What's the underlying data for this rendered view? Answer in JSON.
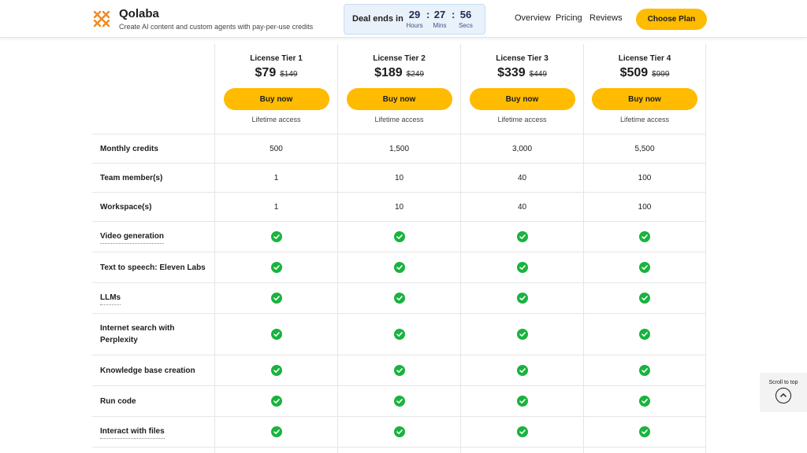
{
  "header": {
    "brand_name": "Qolaba",
    "tagline": "Create AI content and custom agents with pay-per-use credits",
    "deal": {
      "label": "Deal ends in",
      "hours": "29",
      "hours_label": "Hours",
      "mins": "27",
      "mins_label": "Mins",
      "secs": "56",
      "secs_label": "Secs"
    },
    "nav": [
      "Overview",
      "Pricing",
      "Reviews"
    ],
    "cta": "Choose Plan",
    "accent_color": "#ffbb00"
  },
  "tiers": [
    {
      "name": "License Tier 1",
      "price": "$79",
      "old_price": "$149",
      "button": "Buy now",
      "note": "Lifetime access"
    },
    {
      "name": "License Tier 2",
      "price": "$189",
      "old_price": "$249",
      "button": "Buy now",
      "note": "Lifetime access"
    },
    {
      "name": "License Tier 3",
      "price": "$339",
      "old_price": "$449",
      "button": "Buy now",
      "note": "Lifetime access"
    },
    {
      "name": "License Tier 4",
      "price": "$509",
      "old_price": "$999",
      "button": "Buy now",
      "note": "Lifetime access"
    }
  ],
  "features": [
    {
      "label": "Monthly credits",
      "values": [
        "500",
        "1,500",
        "3,000",
        "5,500"
      ]
    },
    {
      "label": "Team member(s)",
      "values": [
        "1",
        "10",
        "40",
        "100"
      ]
    },
    {
      "label": "Workspace(s)",
      "values": [
        "1",
        "10",
        "40",
        "100"
      ]
    },
    {
      "label": "Video generation",
      "check": true
    },
    {
      "label": "Text to speech: Eleven Labs",
      "check": true
    },
    {
      "label": "LLMs",
      "check": true
    },
    {
      "label": "Internet search with Perplexity",
      "check": true
    },
    {
      "label": "Knowledge base creation",
      "check": true
    },
    {
      "label": "Run code",
      "check": true
    },
    {
      "label": "Interact with files",
      "check": true
    }
  ],
  "check_icon": "check-circle-icon",
  "check_color": "#19b33f",
  "scroll_top": {
    "label": "Scroll to top",
    "icon": "chevron-up-icon"
  }
}
